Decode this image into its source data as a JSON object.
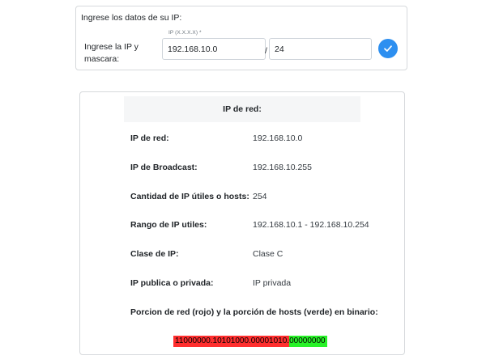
{
  "form": {
    "heading": "Ingrese los datos de su IP:",
    "row_label": "Ingrese la IP y mascara:",
    "ip_float_label": "IP (X.X.X.X) *",
    "ip_value": "192.168.10.0",
    "slash": "/",
    "mask_value": "24",
    "submit_icon": "check-icon",
    "accent_color": "#2d8ff0"
  },
  "result": {
    "title": "IP de red:",
    "rows": [
      {
        "label": "IP de red:",
        "value": "192.168.10.0"
      },
      {
        "label": "IP de Broadcast:",
        "value": "192.168.10.255"
      },
      {
        "label": "Cantidad de IP útiles o hosts:",
        "value": "254"
      },
      {
        "label": "Rango de IP utiles:",
        "value": "192.168.10.1 - 192.168.10.254"
      },
      {
        "label": "Clase de IP:",
        "value": "Clase C"
      },
      {
        "label": "IP publica o privada:",
        "value": "IP privada"
      }
    ],
    "binary_label": "Porcion de red (rojo) y la porción de hosts (verde) en binario:",
    "binary_network": "11000000.10101000.00001010.",
    "binary_host": "00000000",
    "network_color": "#ff2e2e",
    "host_color": "#27f227"
  }
}
